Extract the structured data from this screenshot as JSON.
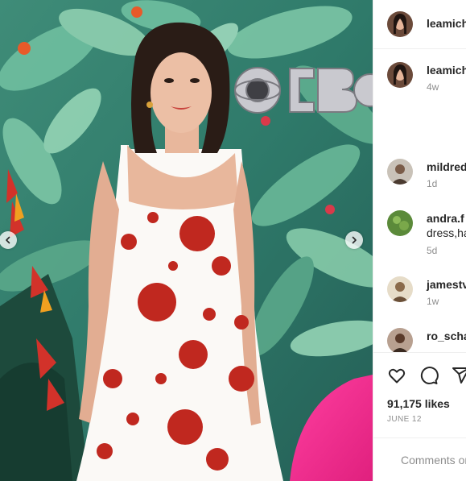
{
  "post": {
    "media": {
      "image_alt": "Woman in a white dress with red floral print posing in front of a tropical leaf backdrop with the CBS logo",
      "backdrop_logo": "CBS",
      "prev_icon": "chevron-left-icon",
      "next_icon": "chevron-right-icon"
    },
    "header": {
      "username": "leamich"
    },
    "caption": {
      "username": "leamich",
      "time": "4w"
    },
    "comments": [
      {
        "username": "mildred",
        "text": "",
        "time": "1d"
      },
      {
        "username": "andra.f",
        "text": "dress,ha",
        "time": "5d"
      },
      {
        "username": "jamestv",
        "text": "",
        "time": "1w"
      },
      {
        "username": "ro_scha",
        "text": "",
        "time": ""
      }
    ],
    "actions": {
      "like_icon": "heart-icon",
      "comment_icon": "comment-icon",
      "share_icon": "share-icon"
    },
    "likes": "91,175 likes",
    "date": "JUNE 12",
    "add_comment": {
      "placeholder": "Comments on"
    }
  },
  "colors": {
    "accent_text": "#262626",
    "muted_text": "#8e8e8e",
    "divider": "#efefef",
    "dress_red": "#c0281f"
  }
}
